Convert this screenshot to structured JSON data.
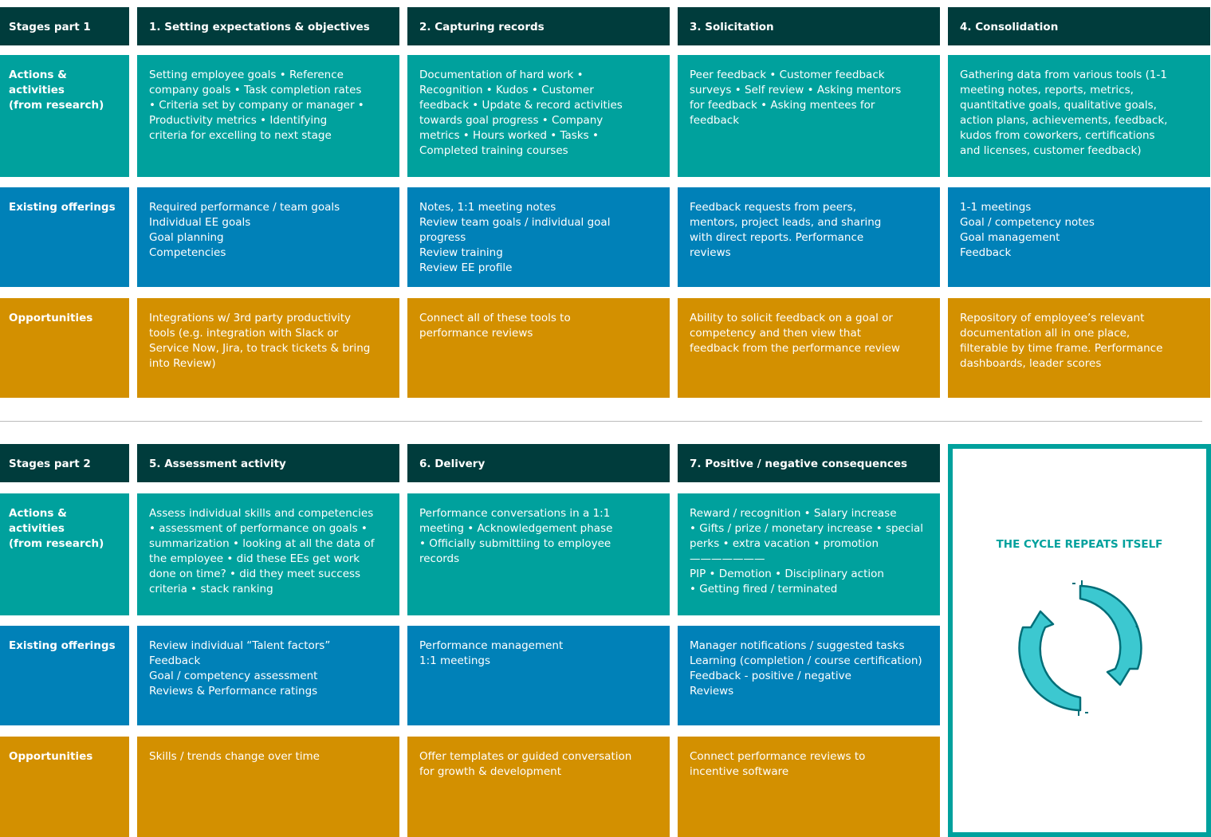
{
  "part1": {
    "row_labels": {
      "stages": "Stages part 1",
      "actions": "Actions & activities\n(from research)",
      "existing": "Existing offerings",
      "opportunities": "Opportunities"
    },
    "stages": [
      {
        "title": "1. Setting expectations & objectives",
        "actions": "Setting employee goals • Reference\ncompany goals • Task completion rates\n• Criteria set by company or manager •\nProductivity metrics • Identifying\ncriteria for excelling to next stage",
        "existing": "Required performance / team goals\nIndividual EE goals\nGoal planning\nCompetencies",
        "opportunities": "Integrations w/ 3rd party productivity\ntools (e.g. integration with Slack or\nService Now, Jira, to track tickets & bring\ninto Review)"
      },
      {
        "title": "2. Capturing records",
        "actions": "Documentation of hard work •\nRecognition • Kudos • Customer\nfeedback • Update & record activities\ntowards goal progress • Company\nmetrics • Hours worked • Tasks •\nCompleted training courses",
        "existing": "Notes, 1:1 meeting notes\nReview team goals / individual goal\nprogress\nReview training\nReview EE profile",
        "opportunities": "Connect all of these tools to\nperformance reviews"
      },
      {
        "title": "3. Solicitation",
        "actions": "Peer feedback • Customer feedback\nsurveys • Self review • Asking mentors\nfor feedback • Asking mentees for\nfeedback",
        "existing": "Feedback requests from peers,\nmentors, project leads, and sharing\nwith direct reports. Performance\nreviews",
        "opportunities": "Ability to solicit feedback on a goal or\ncompetency and then view that\nfeedback from the performance review"
      },
      {
        "title": "4. Consolidation",
        "actions": "Gathering data from various tools (1-1\nmeeting notes, reports, metrics,\nquantitative goals, qualitative goals,\naction plans, achievements, feedback,\nkudos from coworkers, certifications\nand licenses, customer feedback)",
        "existing": "1-1 meetings\nGoal / competency notes\nGoal management\nFeedback",
        "opportunities": "Repository of employee’s relevant\ndocumentation all in one place,\nfilterable by time frame. Performance\ndashboards, leader scores"
      }
    ]
  },
  "part2": {
    "row_labels": {
      "stages": "Stages part 2",
      "actions": "Actions & activities\n(from research)",
      "existing": "Existing offerings",
      "opportunities": "Opportunities"
    },
    "stages": [
      {
        "title": "5. Assessment activity",
        "actions": "Assess individual skills and competencies\n• assessment of performance on goals •\nsummarization • looking at all the data of\nthe employee • did these EEs get work\ndone on time? • did they meet success\ncriteria • stack ranking",
        "existing": "Review individual “Talent factors”\nFeedback\nGoal / competency assessment\nReviews & Performance ratings",
        "opportunities": "Skills / trends change over time"
      },
      {
        "title": "6. Delivery",
        "actions": "Performance conversations in a 1:1\nmeeting • Acknowledgement phase\n• Officially submittiing to employee\nrecords",
        "existing": "Performance management\n1:1 meetings",
        "opportunities": "Offer templates or guided conversation\nfor growth & development"
      },
      {
        "title": "7. Positive / negative consequences",
        "actions": "Reward / recognition • Salary increase\n• Gifts / prize / monetary increase • special\nperks • extra vacation • promotion\n———————\nPIP • Demotion • Disciplinary action\n• Getting fired / terminated",
        "existing": "Manager notifications / suggested tasks\nLearning (completion / course certification)\nFeedback - positive / negative\nReviews",
        "opportunities": "Connect performance reviews to\nincentive software"
      }
    ],
    "cycle": {
      "title": "THE CYCLE REPEATS ITSELF",
      "icon": "cycle-arrows-icon"
    }
  },
  "colors": {
    "header": "#003c3c",
    "actions": "#00a19d",
    "existing": "#0081b8",
    "opportunities": "#d39000",
    "cycle_accent": "#00a19d"
  }
}
